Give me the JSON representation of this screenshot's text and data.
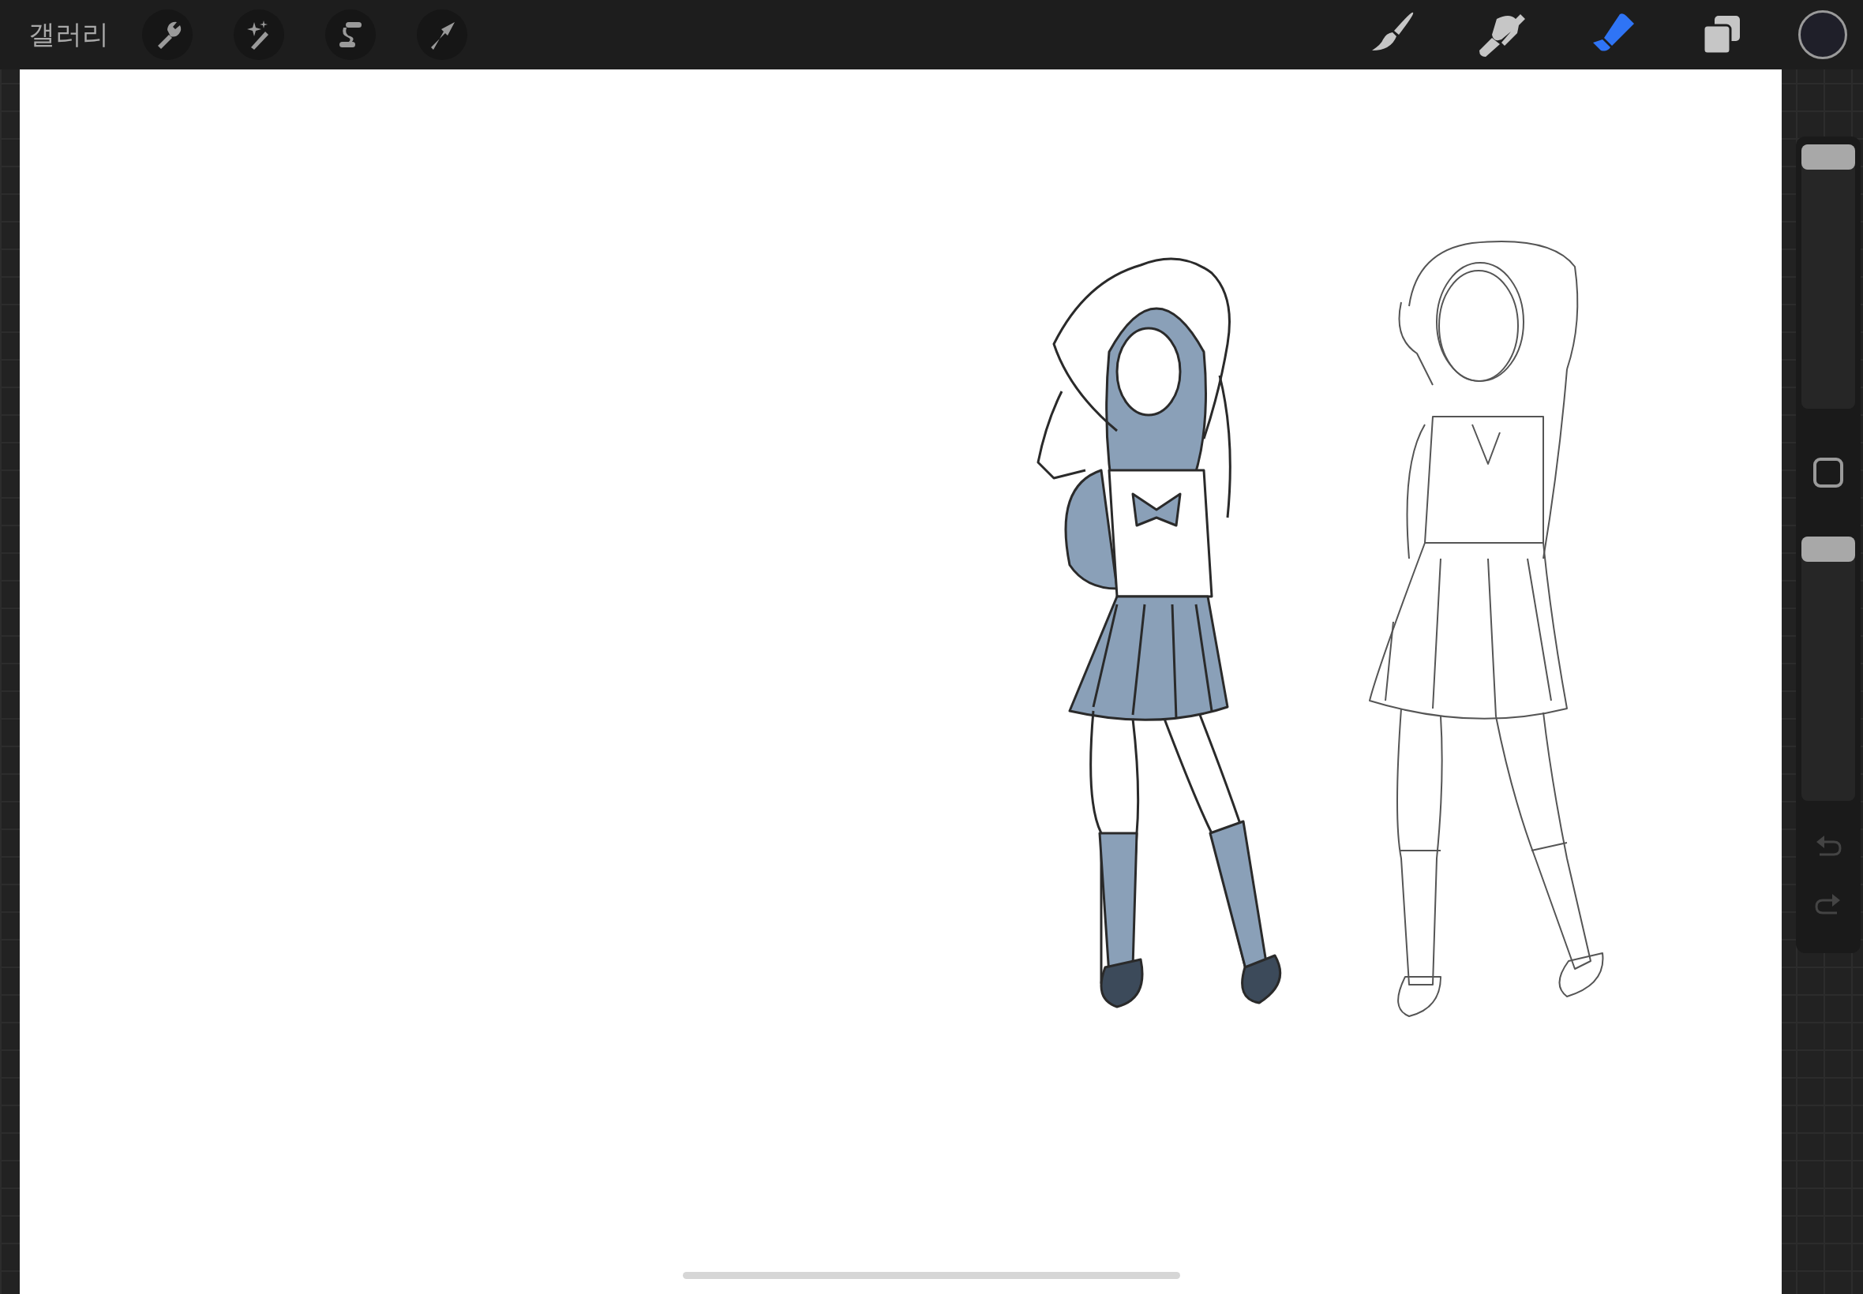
{
  "top_bar": {
    "gallery_label": "갤러리",
    "actions": [
      {
        "kind": "wrench"
      },
      {
        "kind": "wand"
      },
      {
        "kind": "selection"
      },
      {
        "kind": "transform"
      }
    ],
    "tools": [
      {
        "kind": "brush",
        "selected": false
      },
      {
        "kind": "smudge",
        "selected": false
      },
      {
        "kind": "eraser",
        "selected": true
      }
    ]
  },
  "sidebar": {
    "brush_size": {
      "level": 1
    },
    "opacity": {
      "level": 1
    },
    "undo": {
      "disabled": true
    },
    "redo": {
      "disabled": true
    }
  }
}
